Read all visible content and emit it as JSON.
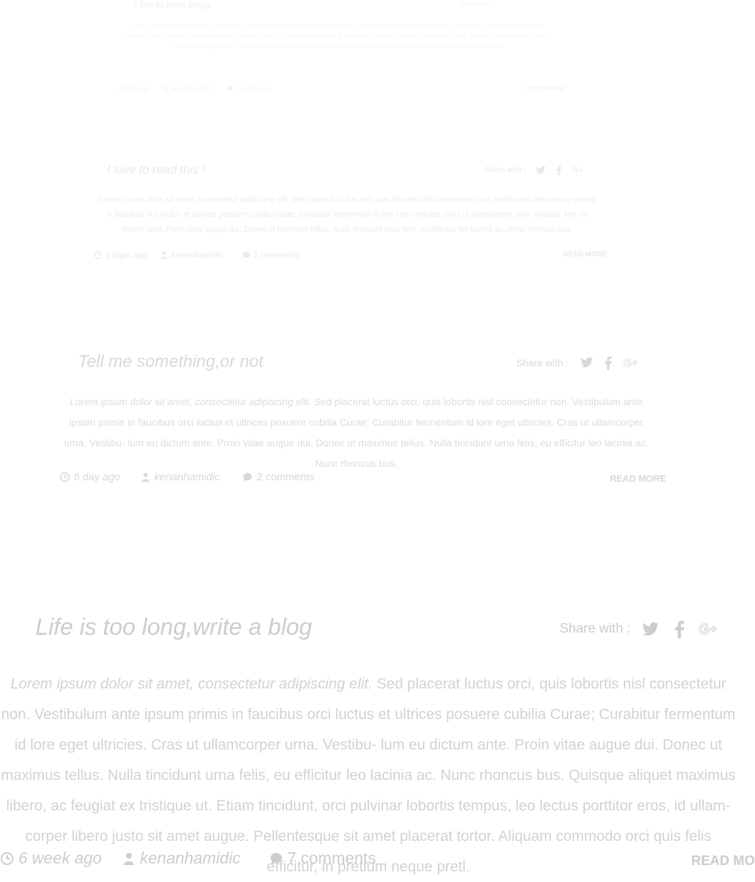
{
  "share_label": "Share with :",
  "read_more": "READ MORE",
  "icons": [
    "twitter-icon",
    "facebook-icon",
    "google-plus-icon",
    "clock-icon",
    "user-icon",
    "comment-icon"
  ],
  "posts": [
    {
      "title": "I like to write blogs",
      "lead": "",
      "body": "",
      "time": "3 h ago",
      "author": "kenanhamidic",
      "comments": "7 comments"
    },
    {
      "title": "I love to read this !",
      "lead": "Lorem ipsum dolor sit amet, consectetur adipiscing elit.",
      "body": " Sed placerat luctus orci, quis lobortis nisl consectetur non. Vestibulum ante ipsum primis in faucibus orci luctus et ultrices posuere cubilia Curae; Curabitur fermentum id lore eget ultricies. Cras ut ullamcorper urna. Vestibu- lum eu dictum ante. Proin vitae augue dui. Donec ut maximus tellus. Nulla tincidunt urna felis, eu efficitur leo lacinia ac. Nunc rhoncus bus.",
      "time": "2 days ago",
      "author": "kenanhamidic",
      "comments": "2 comments"
    },
    {
      "title": "Tell me something,or not",
      "lead": "Lorem ipsum dolor sit amet, consectetur adipiscing elit.",
      "body": " Sed placerat luctus orci, quis lobortis nisl consectetur non. Vestibulum ante ipsum primis in faucibus orci luctus et ultrices posuere cubilia Curae; Curabitur fermentum id lore eget ultricies. Cras ut ullamcorper urna. Vestibu- lum eu dictum ante. Proin vitae augue dui. Donec ut maximus tellus. Nulla tincidunt urna felis, eu efficitur leo lacinia ac. Nunc rhoncus bus.",
      "time": "6 day ago",
      "author": "kenanhamidic",
      "comments": "2 comments"
    },
    {
      "title": "Life is too long,write a blog",
      "lead": "Lorem ipsum dolor sit amet, consectetur adipiscing elit.",
      "body": " Sed placerat luctus orci, quis lobortis nisl consectetur non. Vestibulum ante ipsum primis in faucibus orci luctus et ultrices posuere cubilia Curae; Curabitur fermentum id lore eget ultricies. Cras ut ullamcorper urna. Vestibu- lum eu dictum ante. Proin vitae augue dui. Donec ut maximus tellus. Nulla tincidunt urna felis, eu efficitur leo lacinia ac. Nunc rhoncus bus. Quisque aliquet maximus libero, ac feugiat ex tristique ut. Etiam tincidunt, orci pulvinar lobortis tempus, leo lectus porttitor eros, id ullam- corper libero justo sit amet augue. Pellentesque sit amet placerat tortor. Aliquam commodo orci quis felis efficitur, in pretium neque pretl.",
      "time": "6 week ago",
      "author": "kenanhamidic",
      "comments": "7 comments"
    }
  ]
}
